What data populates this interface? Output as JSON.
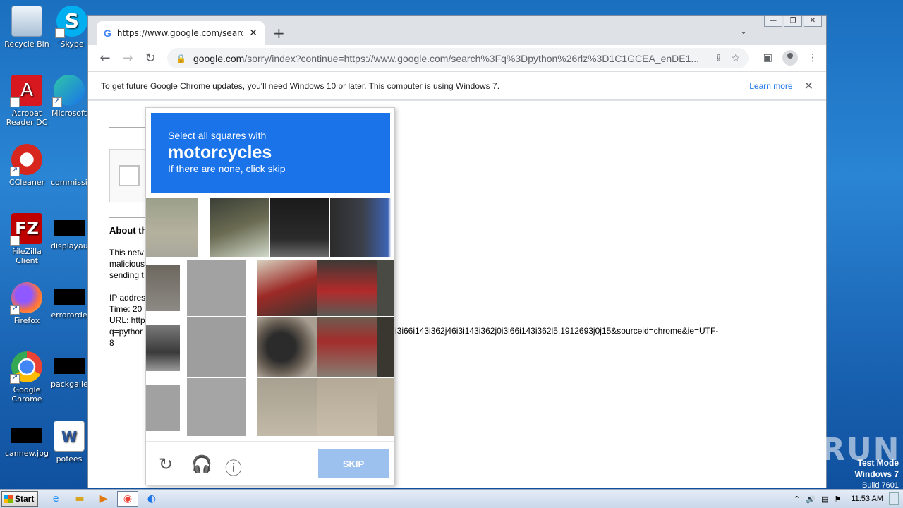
{
  "desktop": {
    "icons": [
      {
        "label": "Recycle Bin",
        "icon": "recycle-bin-icon"
      },
      {
        "label": "Skype",
        "icon": "skype-icon"
      },
      {
        "label": "Acrobat Reader DC",
        "icon": "acrobat-icon"
      },
      {
        "label": "Microsoft",
        "icon": "edge-icon"
      },
      {
        "label": "CCleaner",
        "icon": "ccleaner-icon"
      },
      {
        "label": "commissio",
        "icon": "file-icon"
      },
      {
        "label": "FileZilla Client",
        "icon": "filezilla-icon"
      },
      {
        "label": "displayau",
        "icon": "file-icon"
      },
      {
        "label": "Firefox",
        "icon": "firefox-icon"
      },
      {
        "label": "errororde",
        "icon": "file-icon"
      },
      {
        "label": "Google Chrome",
        "icon": "chrome-icon"
      },
      {
        "label": "packgallei",
        "icon": "file-icon"
      },
      {
        "label": "cannew.jpg",
        "icon": "image-file-icon"
      },
      {
        "label": "pofees",
        "icon": "word-doc-icon"
      }
    ]
  },
  "browser": {
    "tab_title": "https://www.google.com/search?q=",
    "url_host": "google.com",
    "url_rest": "/sorry/index?continue=https://www.google.com/search%3Fq%3Dpython%26rlz%3D1C1GCEA_enDE1...",
    "infobar_message": "To get future Google Chrome updates, you'll need Windows 10 or later. This computer is using Windows 7.",
    "infobar_link": "Learn more"
  },
  "page": {
    "about_heading": "About th",
    "para_lines": [
      "This netv",
      "malicious",
      "sending t"
    ],
    "ip_lines": [
      "IP addres",
      "Time: 20",
      "URL: http",
      "q=pythor",
      "8"
    ],
    "url_tail": "i3i66i143i362j46i3i143i362j0i3i66i143i362l5.1912693j0j15&sourceid=chrome&ie=UTF-"
  },
  "captcha": {
    "line1": "Select all squares with",
    "keyword": "motorcycles",
    "line3": "If there are none, click skip",
    "skip_label": "SKIP"
  },
  "watermark": "ANY RUN",
  "test_mode": {
    "line1": "Test Mode",
    "line2": "Windows 7",
    "line3": "Build 7601"
  },
  "taskbar": {
    "start_label": "Start",
    "clock": "11:53 AM"
  }
}
